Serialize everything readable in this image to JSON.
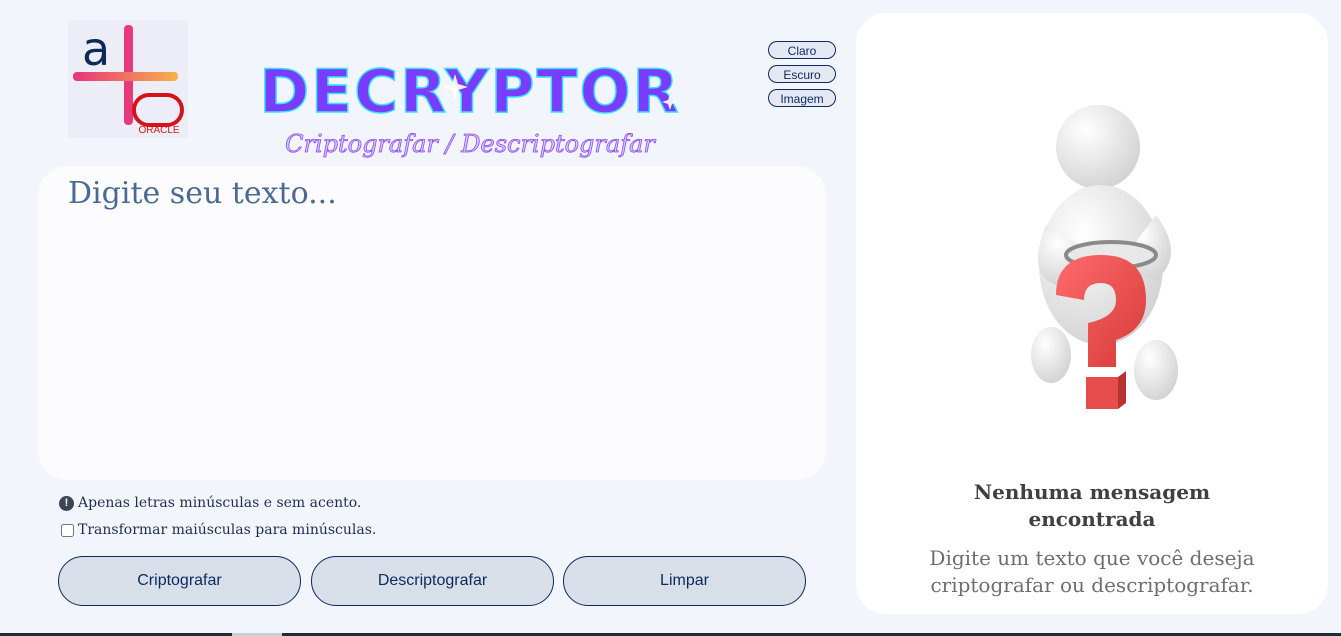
{
  "header": {
    "logo_text": "a",
    "logo_sub": "ORACLE",
    "title": "DECRYPTOR",
    "subtitle": "Criptografar / Descriptografar"
  },
  "theme": {
    "light": "Claro",
    "dark": "Escuro",
    "image": "Imagem"
  },
  "editor": {
    "placeholder": "Digite seu texto..."
  },
  "notice": {
    "icon": "exclamation-circle-icon",
    "text": "Apenas letras minúsculas e sem acento."
  },
  "lowercase": {
    "label": "Transformar maiúsculas para minúsculas.",
    "checked": false
  },
  "actions": {
    "encrypt": "Criptografar",
    "decrypt": "Descriptografar",
    "clear": "Limpar"
  },
  "output": {
    "title_line1": "Nenhuma mensagem",
    "title_line2": "encontrada",
    "desc_line1": "Digite um texto que você deseja",
    "desc_line2": "criptografar ou descriptografar."
  },
  "colors": {
    "background": "#f3f5fc",
    "accent": "#0b2a5c",
    "title_gradient_start": "#4cc6ff",
    "title_gradient_end": "#a13bff"
  }
}
